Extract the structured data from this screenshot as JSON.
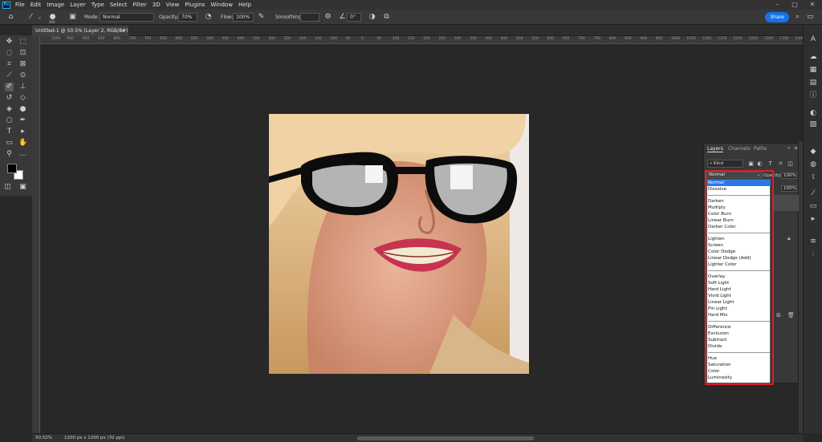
{
  "app": {
    "logo": "Ps"
  },
  "menu": [
    "File",
    "Edit",
    "Image",
    "Layer",
    "Type",
    "Select",
    "Filter",
    "3D",
    "View",
    "Plugins",
    "Window",
    "Help"
  ],
  "window_controls": {
    "minimize": "–",
    "maximize": "□",
    "close": "✕"
  },
  "options_bar": {
    "brush_size": "400",
    "mode_label": "Mode:",
    "mode_value": "Normal",
    "opacity_label": "Opacity:",
    "opacity_value": "70%",
    "flow_label": "Flow:",
    "flow_value": "100%",
    "smoothing_label": "Smoothing:",
    "angle_value": "0°",
    "share_label": "Share"
  },
  "document_tab": {
    "title": "Untitled-1 @ 50.5% (Layer 2, RGB/8#) *",
    "close": "×"
  },
  "ruler_ticks": [
    "1000",
    "950",
    "900",
    "850",
    "800",
    "750",
    "700",
    "650",
    "600",
    "550",
    "500",
    "450",
    "400",
    "350",
    "300",
    "250",
    "200",
    "150",
    "100",
    "50",
    "0",
    "50",
    "100",
    "150",
    "200",
    "250",
    "300",
    "350",
    "400",
    "450",
    "500",
    "550",
    "600",
    "650",
    "700",
    "750",
    "800",
    "850",
    "900",
    "950",
    "1000",
    "1050",
    "1100",
    "1150",
    "1200",
    "1250",
    "1300",
    "1350",
    "1400",
    "1450"
  ],
  "layers_panel": {
    "tabs": [
      "Layers",
      "Channels",
      "Paths"
    ],
    "filter_kind": "Kind",
    "blend_mode": "Normal",
    "opacity_label": "Opacity:",
    "opacity_value": "100%",
    "fill_value": "100%"
  },
  "blend_modes": [
    [
      "Normal",
      "Dissolve"
    ],
    [
      "Darken",
      "Multiply",
      "Color Burn",
      "Linear Burn",
      "Darker Color"
    ],
    [
      "Lighten",
      "Screen",
      "Color Dodge",
      "Linear Dodge (Add)",
      "Lighter Color"
    ],
    [
      "Overlay",
      "Soft Light",
      "Hard Light",
      "Vivid Light",
      "Linear Light",
      "Pin Light",
      "Hard Mix"
    ],
    [
      "Difference",
      "Exclusion",
      "Subtract",
      "Divide"
    ],
    [
      "Hue",
      "Saturation",
      "Color",
      "Luminosity"
    ]
  ],
  "blend_selected": "Normal",
  "status": {
    "zoom": "50.52%",
    "doc_info": "1200 px x 1200 px (72 ppi)"
  },
  "colors": {
    "accent": "#1473e6",
    "highlight_box": "#d9202a",
    "selected_option": "#2b78e4"
  }
}
